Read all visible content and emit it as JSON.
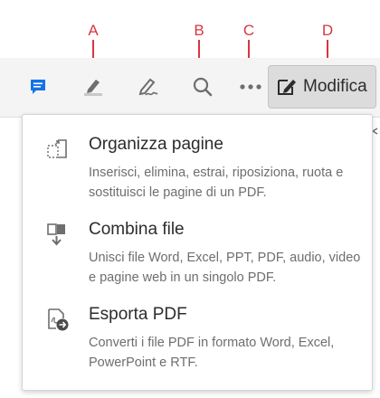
{
  "callouts": [
    "A",
    "B",
    "C",
    "D"
  ],
  "toolbar": {
    "modifica_label": "Modifica"
  },
  "menu": {
    "items": [
      {
        "title": "Organizza pagine",
        "description": "Inserisci, elimina, estrai, riposiziona, ruota e sostituisci le pagine di un PDF.",
        "icon": "organize-pages-icon"
      },
      {
        "title": "Combina file",
        "description": "Unisci file Word, Excel, PPT, PDF, audio, video e pagine web in un singolo PDF.",
        "icon": "combine-files-icon"
      },
      {
        "title": "Esporta PDF",
        "description": "Converti i file PDF in formato Word, Excel, PowerPoint e RTF.",
        "icon": "export-pdf-icon"
      }
    ]
  },
  "colors": {
    "callout": "#d7373f",
    "comment_icon": "#1473e6",
    "toolbar_bg": "#f4f4f4",
    "button_bg": "#dcdcdc",
    "text_primary": "#2c2c2c",
    "text_secondary": "#6e6e6e"
  }
}
